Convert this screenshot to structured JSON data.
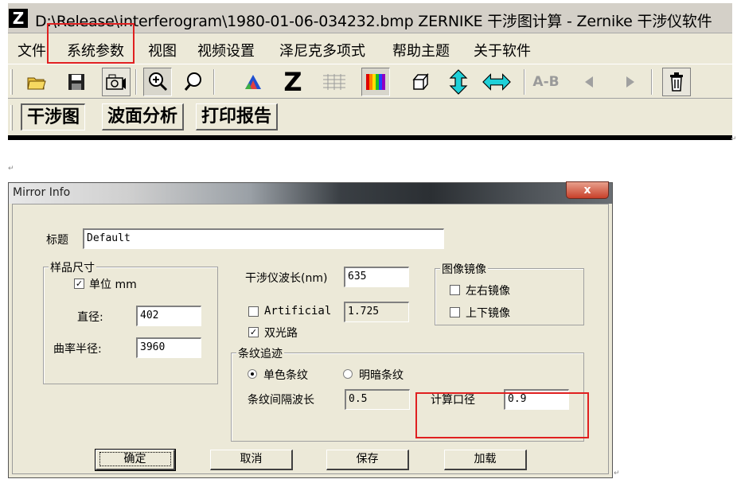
{
  "app": {
    "logo_letter": "Z",
    "title": "D:\\Release\\interferogram\\1980-01-06-034232.bmp ZERNIKE 干涉图计算 - Zernike 干涉仪软件",
    "menu": [
      "文件",
      "系统参数",
      "视图",
      "视频设置",
      "泽尼克多项式",
      "帮助主题",
      "关于软件"
    ],
    "highlight_color": "#e02020",
    "toolbar": {
      "icons": [
        "open-folder-icon",
        "save-disk-icon",
        "camera-icon",
        "zoom-in-icon",
        "zoom-out-icon",
        "color-palette-icon",
        "zernike-z-icon",
        "grid-icon",
        "rainbow-spectrum-icon",
        "cube-3d-icon",
        "vertical-arrows-icon",
        "horizontal-arrows-icon",
        "a-b-icon",
        "previous-arrow-icon",
        "next-arrow-icon",
        "trash-icon"
      ],
      "z_label": "Z",
      "ab_label": "A-B"
    },
    "tabs": [
      "干涉图",
      "波面分析",
      "打印报告"
    ]
  },
  "dialog": {
    "title": "Mirror Info",
    "close_glyph": "x",
    "title_label": "标题",
    "title_value": "Default",
    "sample_group": {
      "title": "样品尺寸",
      "unit_label": "单位 mm",
      "unit_checked": true,
      "diameter_label": "直径:",
      "diameter_value": "402",
      "radius_label": "曲率半径:",
      "radius_value": "3960"
    },
    "wavelength_label": "干涉仪波长(nm)",
    "wavelength_value": "635",
    "artificial_label": "Artificial",
    "artificial_checked": false,
    "artificial_value": "1.725",
    "double_pass_label": "双光路",
    "double_pass_checked": true,
    "mirror_group": {
      "title": "图像镜像",
      "lr_label": "左右镜像",
      "lr_checked": false,
      "ud_label": "上下镜像",
      "ud_checked": false
    },
    "fringe_group": {
      "title": "条纹追迹",
      "mono_label": "单色条纹",
      "mono_selected": true,
      "bright_dark_label": "明暗条纹",
      "bright_dark_selected": false,
      "spacing_label": "条纹间隔波长",
      "spacing_value": "0.5",
      "aperture_label": "计算口径",
      "aperture_value": "0.9"
    },
    "buttons": {
      "ok": "确定",
      "cancel": "取消",
      "save": "保存",
      "load": "加载"
    }
  },
  "page_marks": {
    "return_mark": "↵"
  }
}
